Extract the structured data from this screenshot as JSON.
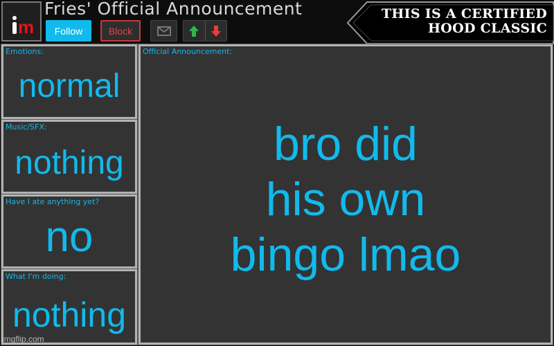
{
  "header": {
    "logo_text": "im",
    "title": "Fries' Official Announcement",
    "buttons": {
      "follow": "Follow",
      "block": "Block",
      "message_icon": "envelope-icon",
      "upvote_icon": "arrow-up-icon",
      "downvote_icon": "arrow-down-icon"
    },
    "banner": {
      "line1": "THIS IS A CERTIFIED",
      "line2": "HOOD CLASSIC"
    }
  },
  "panels": {
    "emotions": {
      "label": "Emotions:",
      "value": "normal"
    },
    "music": {
      "label": "Music/SFX:",
      "value": "nothing"
    },
    "ate": {
      "label": "Have I ate anything yet?",
      "value": "no"
    },
    "doing": {
      "label": "What I'm doing:",
      "value": "nothing"
    },
    "announcement": {
      "label": "Official Announcement:",
      "lines": [
        "bro did",
        "his own",
        "bingo lmao"
      ]
    }
  },
  "watermark": "imgflip.com",
  "colors": {
    "accent": "#11baec",
    "block": "#e04446",
    "upvote": "#2db84a",
    "downvote": "#f0393c",
    "panel_bg": "#333333",
    "panel_border": "#b3b3b3"
  }
}
